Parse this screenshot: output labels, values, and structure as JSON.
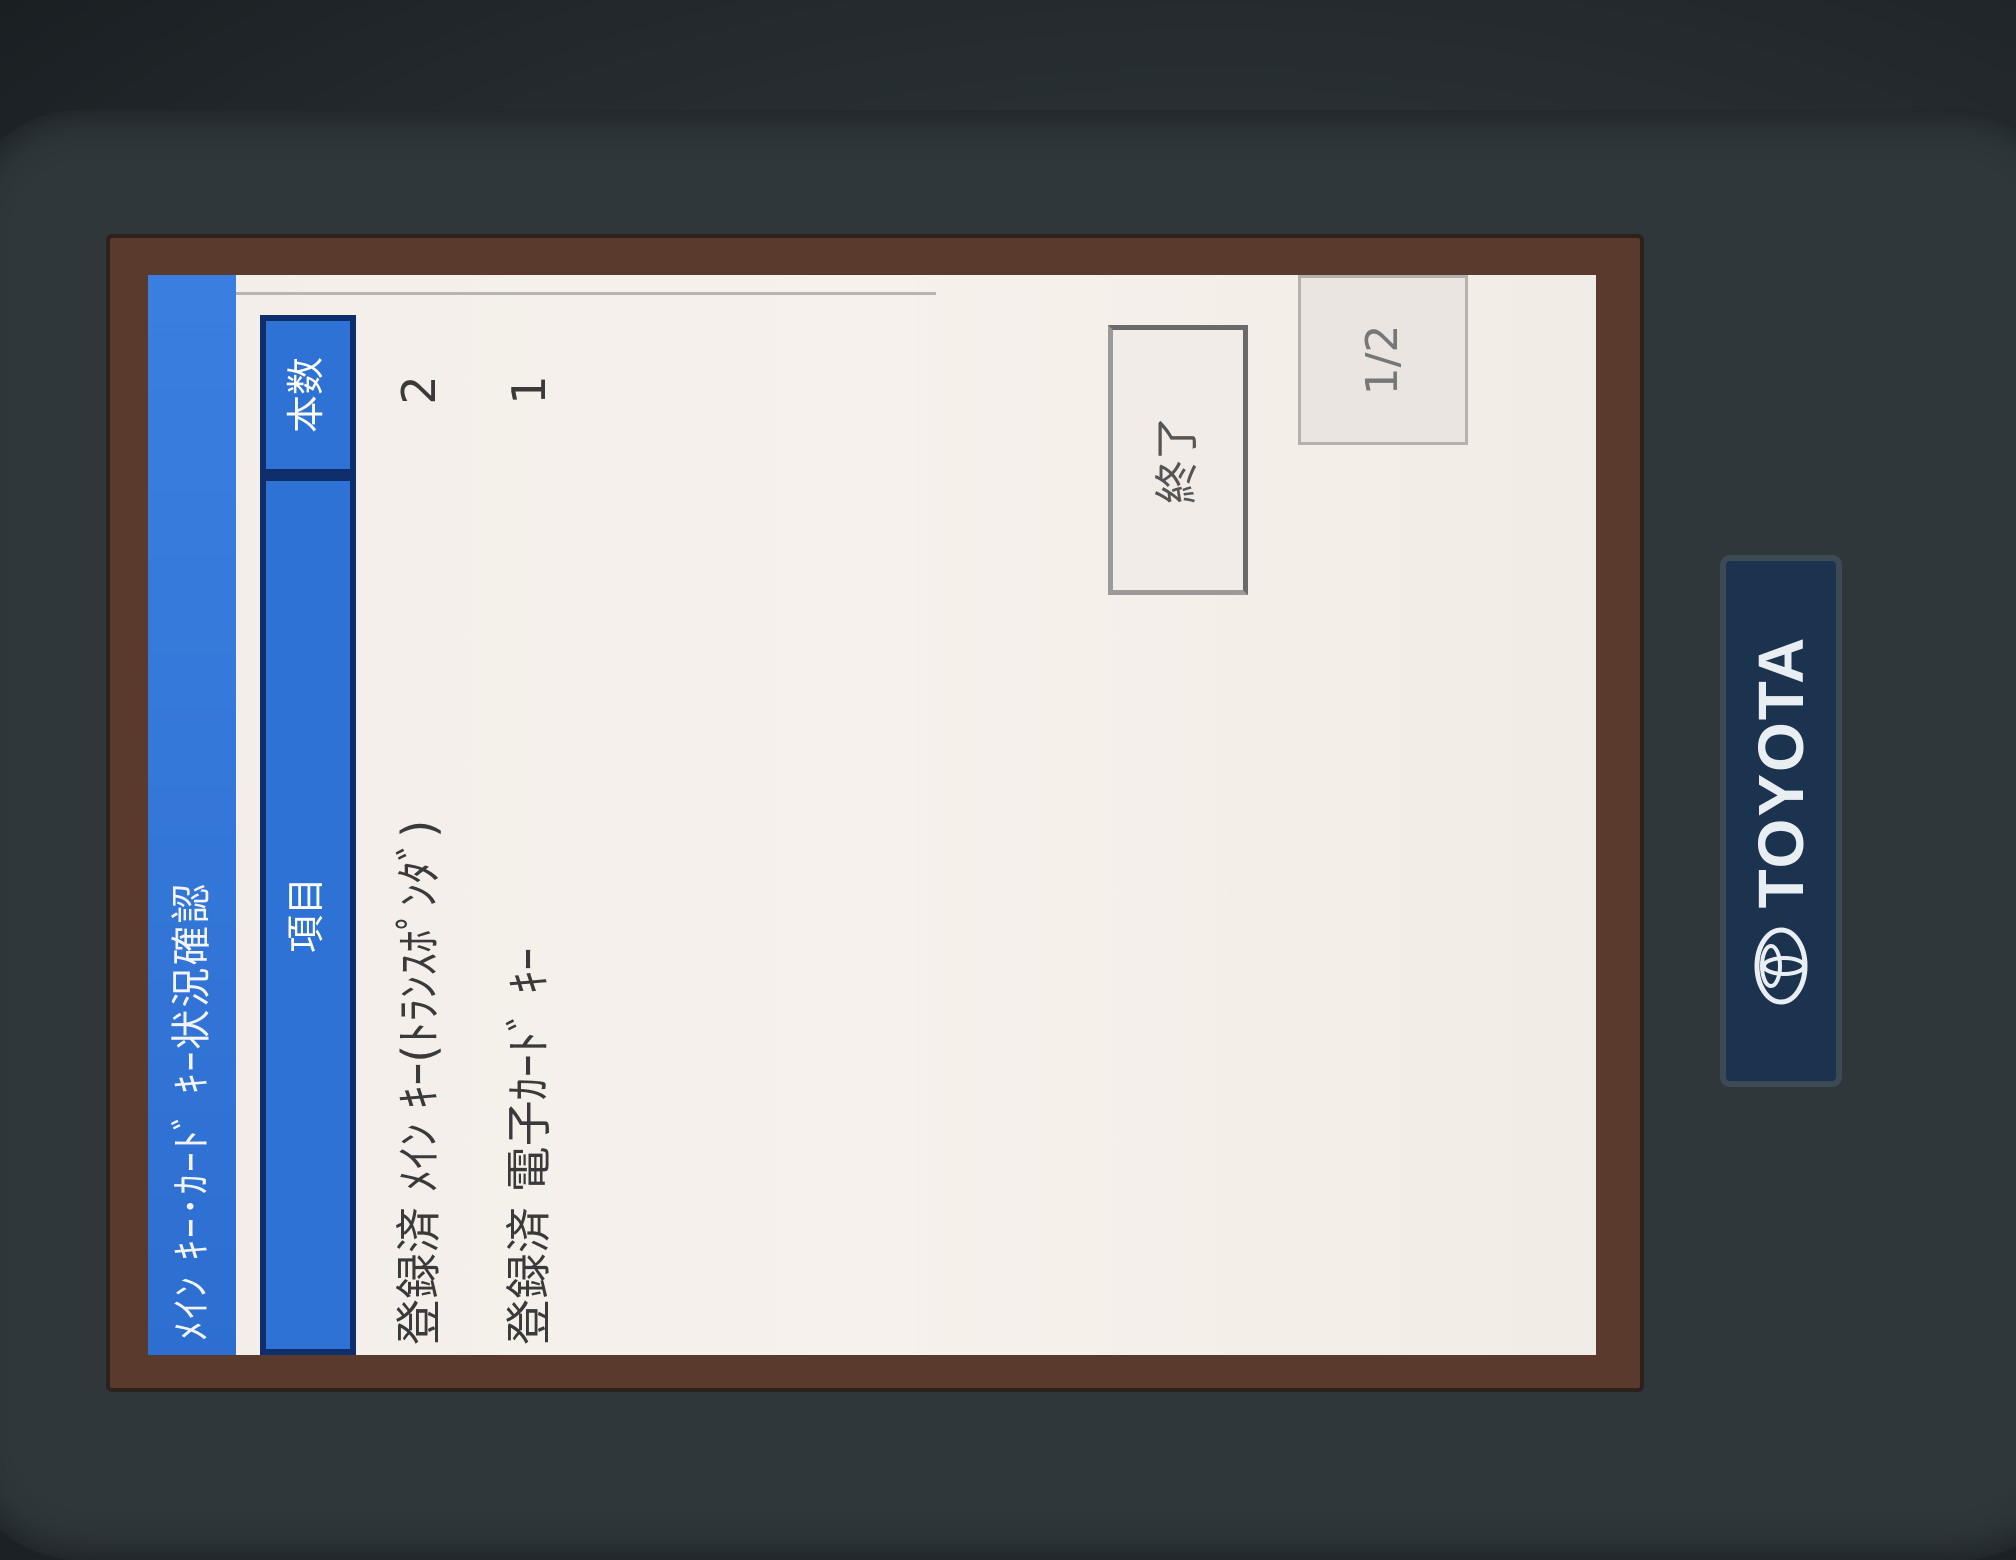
{
  "screen": {
    "title": "ﾒｲﾝ ｷｰ･ｶｰﾄﾞ ｷｰ状況確認",
    "columns": {
      "item": "項目",
      "count": "本数"
    },
    "rows": [
      {
        "label": "登録済 ﾒｲﾝ ｷｰ(ﾄﾗﾝｽﾎﾟﾝﾀﾞ)",
        "count": "2"
      },
      {
        "label": "登録済 電子ｶｰﾄﾞ ｷｰ",
        "count": "1"
      }
    ],
    "finish_label": "終了",
    "page_indicator": "1/2"
  },
  "device": {
    "brand": "TOYOTA",
    "emblem": "toyota-emblem-icon"
  },
  "colors": {
    "title_bar": "#3a7fe0",
    "header": "#2f72d6",
    "screen_bg": "#f4efea",
    "logo_plate": "#1c3350"
  }
}
